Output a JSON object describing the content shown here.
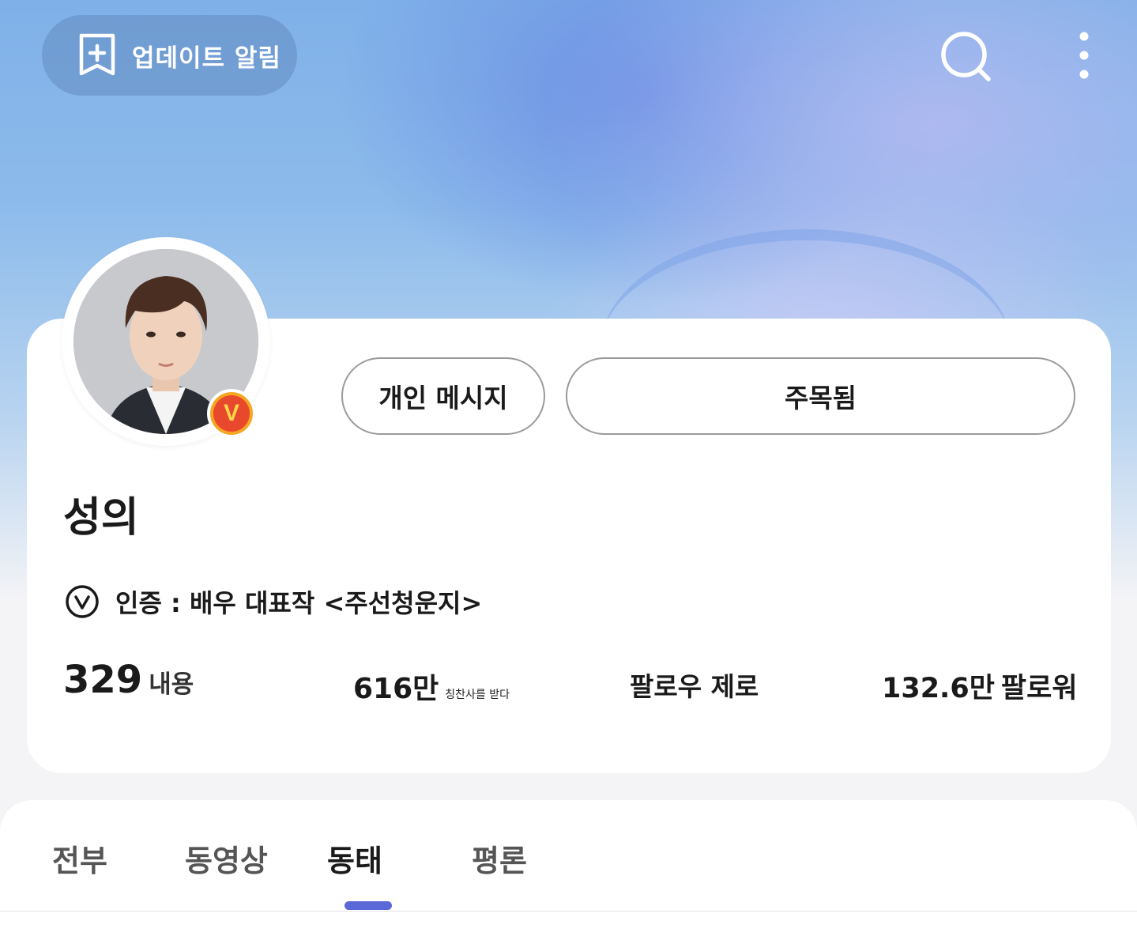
{
  "header": {
    "update_alert_label": "업데이트 알림",
    "search_icon": "search-icon",
    "more_icon": "more-vertical-icon"
  },
  "profile": {
    "name": "성의",
    "verified_badge": "V",
    "verification_text": "인증 : 배우 대표작 <주선청운지>",
    "actions": {
      "message_label": "개인 메시지",
      "follow_label": "주목됨"
    },
    "stats": {
      "posts_value": "329",
      "posts_label": "내용",
      "likes_value": "616만",
      "likes_label": "칭찬사를 받다",
      "following_label": "팔로우 제로",
      "followers_value": "132.6만",
      "followers_label": "팔로워"
    }
  },
  "tabs": [
    {
      "label": "전부"
    },
    {
      "label": "동영상"
    },
    {
      "label": "동태",
      "active": true
    },
    {
      "label": "평론"
    }
  ],
  "colors": {
    "accent": "#5a68d8",
    "badge_orange": "#f5a623",
    "badge_red": "#e8482c"
  }
}
